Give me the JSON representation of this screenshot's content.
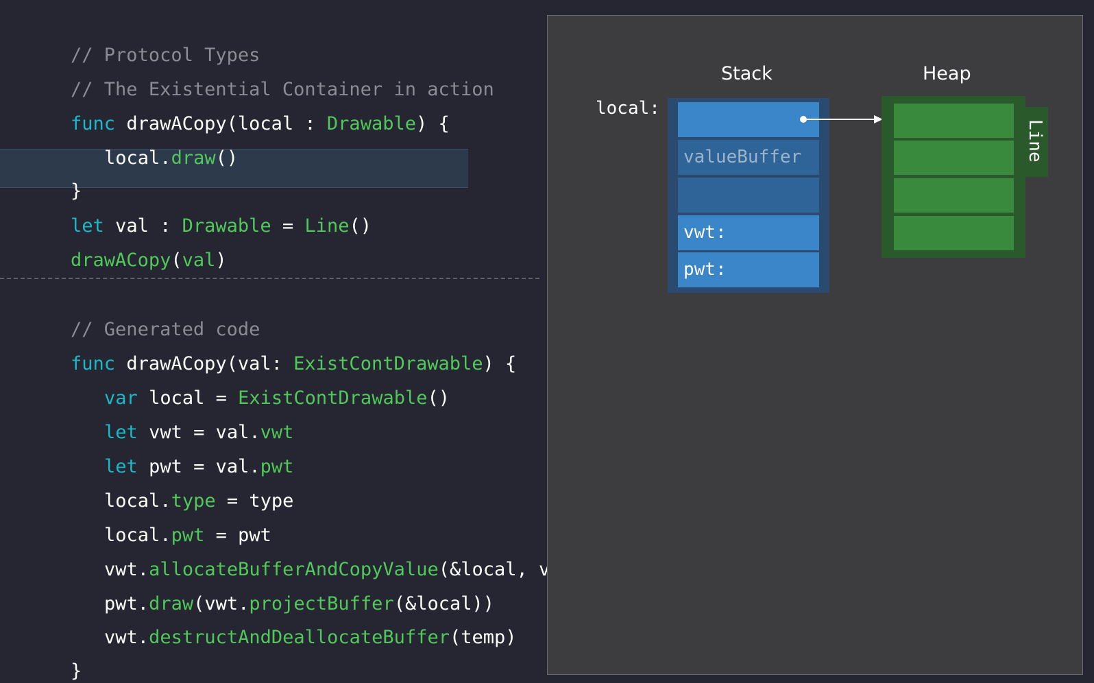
{
  "code_top": {
    "comment_1": "// Protocol Types",
    "comment_2": "// The Existential Container in action",
    "line_1": {
      "kw": "func",
      "name": " drawACopy(local : ",
      "type": "Drawable",
      "rest": ") {"
    },
    "line_2": {
      "obj": "local.",
      "call": "draw",
      "rest": "()"
    },
    "line_3": "}",
    "line_4": {
      "kw": "let",
      "name": " val : ",
      "type": "Drawable",
      "eq": " = ",
      "ctor": "Line",
      "rest": "()"
    },
    "line_5": {
      "call": "drawACopy",
      "open": "(",
      "arg": "val",
      "close": ")"
    }
  },
  "code_bottom": {
    "comment": "// Generated code",
    "line_1": {
      "kw": "func",
      "name": " drawACopy(val: ",
      "type": "ExistContDrawable",
      "rest": ") {"
    },
    "line_2": {
      "kw": "var",
      "name": " local = ",
      "ctor": "ExistContDrawable",
      "rest": "()"
    },
    "line_3": {
      "kw": "let",
      "name": " vwt = val.",
      "prop": "vwt"
    },
    "line_4": {
      "kw": "let",
      "name": " pwt = val.",
      "prop": "pwt"
    },
    "line_5": {
      "obj": "local.",
      "prop": "type",
      "rest": " = type"
    },
    "line_6": {
      "obj": "local.",
      "prop": "pwt",
      "rest": " = pwt"
    },
    "line_7": {
      "obj": "vwt.",
      "call": "allocateBufferAndCopyValue",
      "rest": "(&local, val)"
    },
    "line_8": {
      "obj": "pwt.",
      "call": "draw",
      "mid": "(vwt.",
      "call2": "projectBuffer",
      "rest": "(&local))"
    },
    "line_9": {
      "obj": "vwt.",
      "call": "destructAndDeallocateBuffer",
      "rest": "(temp)"
    },
    "line_10": "}"
  },
  "diagram": {
    "stack_heading": "Stack",
    "heap_heading": "Heap",
    "local_label": "local:",
    "stack_cells": [
      "",
      "valueBuffer",
      "",
      "vwt:",
      "pwt:"
    ],
    "heap_tab_label": "Line"
  },
  "colors": {
    "background": "#252631",
    "keyword": "#1bb9c8",
    "type": "#50c85a",
    "comment": "#8b8b94",
    "stack": "#3a86c8",
    "heap": "#3a8a3e"
  }
}
